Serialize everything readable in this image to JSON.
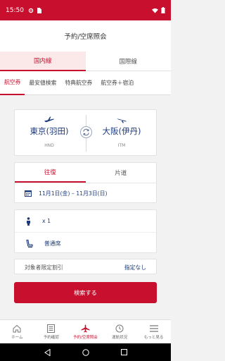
{
  "status_bar": {
    "time": "15:50"
  },
  "header": {
    "title": "予約/空席照会"
  },
  "segment": {
    "items": [
      "国内線",
      "国際線"
    ],
    "active": 0
  },
  "tabs": {
    "items": [
      "航空券",
      "最安値検索",
      "特典航空券",
      "航空券＋宿泊"
    ],
    "active": 0
  },
  "route": {
    "from_city": "東京(羽田)",
    "from_code": "HND",
    "to_city": "大阪(伊丹)",
    "to_code": "ITM"
  },
  "trip": {
    "tabs": [
      "往復",
      "片道"
    ],
    "active": 0,
    "dates": "11月1日(金) – 11月3日(日)"
  },
  "passengers": {
    "count": "x 1",
    "seat_class": "普通席"
  },
  "discount": {
    "label": "対象者限定割引",
    "value": "指定なし"
  },
  "search_button": "検索する",
  "bottom_nav": {
    "items": [
      "ホーム",
      "予約確認",
      "予約/空席照会",
      "運航状況",
      "もっと見る"
    ],
    "active": 2
  },
  "colors": {
    "brand": "#c8102e",
    "navy": "#1d3a7a"
  },
  "icons": [
    "settings-icon",
    "sim-icon",
    "wifi-icon",
    "battery-icon",
    "plane-icon",
    "swap-icon",
    "calendar-icon",
    "person-icon",
    "seat-icon",
    "home-icon",
    "list-icon",
    "clock-icon",
    "menu-icon",
    "back-icon",
    "home-circle-icon",
    "recents-icon"
  ]
}
